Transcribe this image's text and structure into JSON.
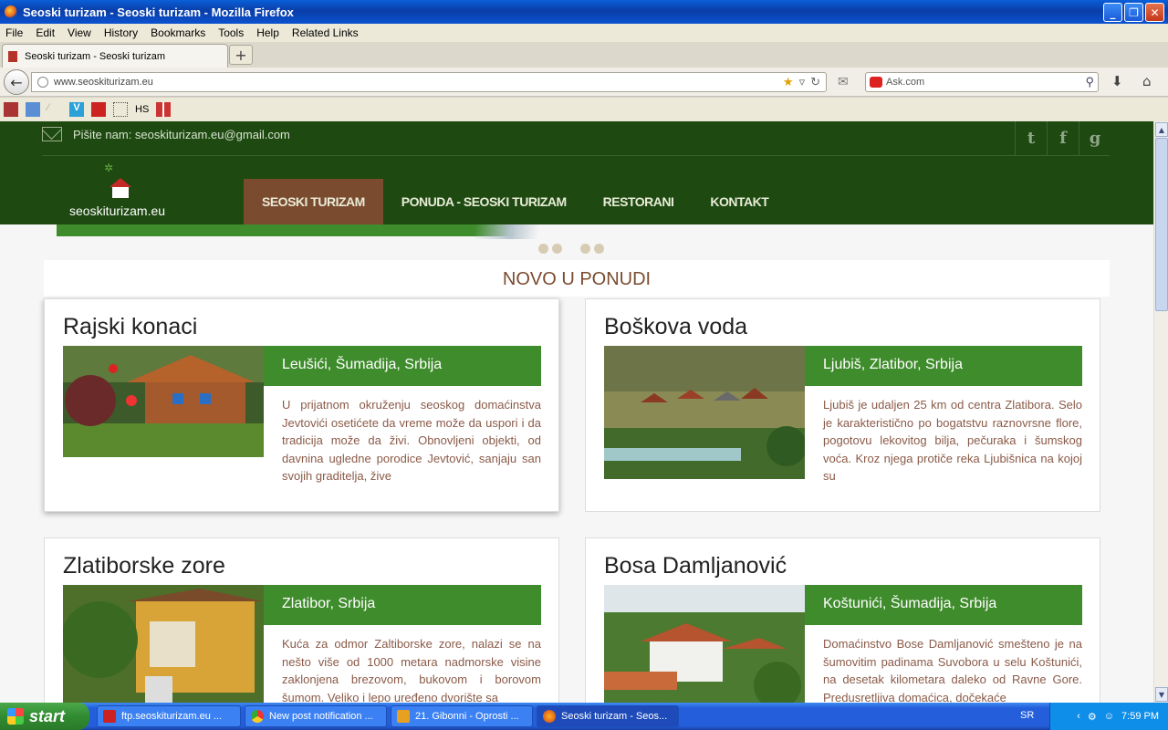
{
  "window": {
    "title": "Seoski turizam - Seoski turizam - Mozilla Firefox"
  },
  "menu": [
    "File",
    "Edit",
    "View",
    "History",
    "Bookmarks",
    "Tools",
    "Help",
    "Related Links"
  ],
  "tab": {
    "title": "Seoski turizam - Seoski turizam"
  },
  "url": "www.seoskiturizam.eu",
  "search": {
    "placeholder": "Ask.com"
  },
  "bookmarks_text": "HS",
  "site": {
    "contact": "Pišite nam: seoskiturizam.eu@gmail.com",
    "social": [
      "t",
      "f",
      "g"
    ],
    "logo_text": "seoskiturizam.eu",
    "nav": [
      "SEOSKI TURIZAM",
      "PONUDA - SEOSKI TURIZAM",
      "RESTORANI",
      "KONTAKT"
    ],
    "section_title": "NOVO U PONUDI",
    "cards": [
      {
        "title": "Rajski konaci",
        "location": "Leušići, Šumadija, Srbija",
        "text": "U prijatnom okruženju seoskog domaćinstva Jevtovići osetićete da vreme može da uspori i da tradicija može da živi. Obnovljeni objekti, od davnina ugledne porodice Jevtović, sanjaju san svojih graditelja, žive"
      },
      {
        "title": "Boškova voda",
        "location": "Ljubiš, Zlatibor, Srbija",
        "text": "Ljubiš je udaljen 25 km od centra Zlatibora. Selo je karakteristično po bogatstvu raznovrsne flore, pogotovu lekovitog bilja, pečuraka i šumskog voća. Kroz njega protiče reka Ljubišnica na kojoj su"
      },
      {
        "title": "Zlatiborske zore",
        "location": "Zlatibor, Srbija",
        "text": "Kuća za odmor Zaltiborske zore, nalazi se na nešto više od 1000 metara nadmorske visine zaklonjena brezovom, bukovom i borovom šumom. Veliko i lepo uređeno dvorište sa"
      },
      {
        "title": "Bosa Damljanović",
        "location": "Koštunići, Šumadija, Srbija",
        "text": "Domaćinstvo Bose Damljanović smešteno je na šumovitim padinama Suvobora u selu Koštunići, na desetak kilometara daleko od Ravne Gore. Predusretljiva domaćica, dočekaće"
      }
    ]
  },
  "taskbar": {
    "start": "start",
    "items": [
      "ftp.seoskiturizam.eu ...",
      "New post notification ...",
      "21. Gibonni - Oprosti ...",
      "Seoski turizam - Seos..."
    ],
    "lang": "SR",
    "time": "7:59 PM"
  }
}
